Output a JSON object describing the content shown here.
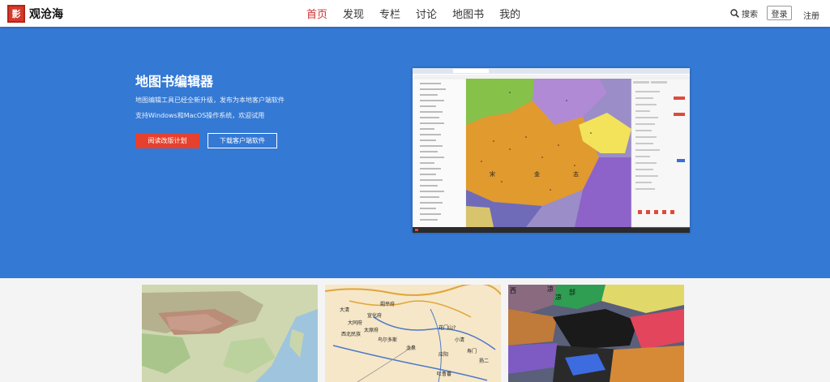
{
  "logo": {
    "text": "观沧海"
  },
  "nav": {
    "items": [
      {
        "label": "首页",
        "active": true
      },
      {
        "label": "发现",
        "active": false
      },
      {
        "label": "专栏",
        "active": false
      },
      {
        "label": "讨论",
        "active": false
      },
      {
        "label": "地图书",
        "active": false
      },
      {
        "label": "我的",
        "active": false
      }
    ]
  },
  "header": {
    "search_label": "搜索",
    "login_label": "登录",
    "register_label": "注册"
  },
  "hero": {
    "title": "地图书编辑器",
    "desc1": "地图编辑工具已经全新升级，发布为本地客户端软件",
    "desc2": "支持Windows和MacOS操作系统，欢迎试用",
    "btn_primary": "阅读改版计划",
    "btn_secondary": "下载客户端软件"
  },
  "app_screenshot": {
    "map_labels": [
      "宋",
      "金",
      "志"
    ]
  },
  "cards": {
    "card2_labels": [
      "大清",
      "朔平府",
      "大同府",
      "宣化府",
      "西北民族",
      "鸟尔多斯",
      "花门山?",
      "龙泉",
      "小清",
      "应阳",
      "扬二",
      "太原府",
      "寿门",
      "吐鲁番"
    ],
    "card3_labels": [
      "西",
      "部",
      "凉",
      "凉"
    ]
  },
  "colors": {
    "brand_red": "#d32f2f",
    "hero_blue": "#3479d4",
    "button_red": "#e5412e"
  }
}
